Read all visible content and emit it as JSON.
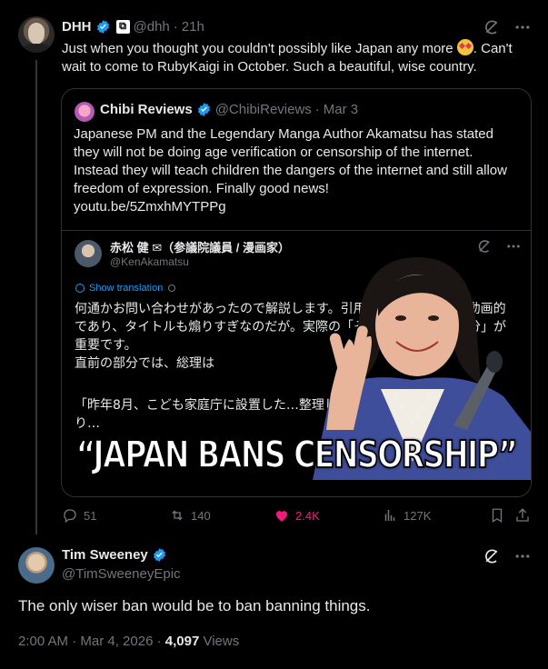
{
  "tweet1": {
    "author_name": "DHH",
    "author_handle": "@dhh",
    "time": "21h",
    "text_before_emoji": "Just when you thought you couldn't possibly like Japan any more ",
    "emoji": "star-struck-emoji",
    "text_after_emoji": ". Can't wait to come to RubyKaigi in October. Such a beautiful, wise country.",
    "quote": {
      "author_name": "Chibi Reviews",
      "author_handle": "@ChibiReviews",
      "time": "Mar 3",
      "text": "Japanese PM and the Legendary Manga Author Akamatsu has stated they will not be doing age verification or censorship of the internet. Instead they will teach children the dangers of the internet and still allow freedom of expression. Finally good news!",
      "link": "youtu.be/5ZmxhMYTPPg",
      "media": {
        "name": "赤松 健 ✉（参議院議員 / 漫画家）",
        "handle": "@KenAkamatsu",
        "show_translation": "Show translation",
        "jp_text_1": "何通かお問い合わせがあったので解説します。引用元動画は切り抜き動画的であり、タイトルも煽りすぎなのだが。実際の「その答弁の直前の部分」が重要です。",
        "jp_text_2": "直前の部分では、総理は",
        "jp_text_3": "「昨年8月、こども家庭庁に設置した…整理し、9月には政府の工程表が取り…",
        "headline": "“JAPAN BANS CENSORSHIP”"
      }
    },
    "actions": {
      "replies": "51",
      "reposts": "140",
      "likes": "2.4K",
      "views": "127K"
    }
  },
  "tweet2": {
    "author_name": "Tim Sweeney",
    "author_handle": "@TimSweeneyEpic",
    "text": "The only wiser ban would be to ban banning things.",
    "timestamp": "2:00 AM · Mar 4, 2026 · ",
    "views_count": "4,097",
    "views_label": " Views"
  },
  "colors": {
    "background": "#000000",
    "text": "#e7e9ea",
    "muted": "#71767b",
    "accent": "#1d9bf0",
    "like": "#f91880",
    "border": "#2f3336"
  }
}
